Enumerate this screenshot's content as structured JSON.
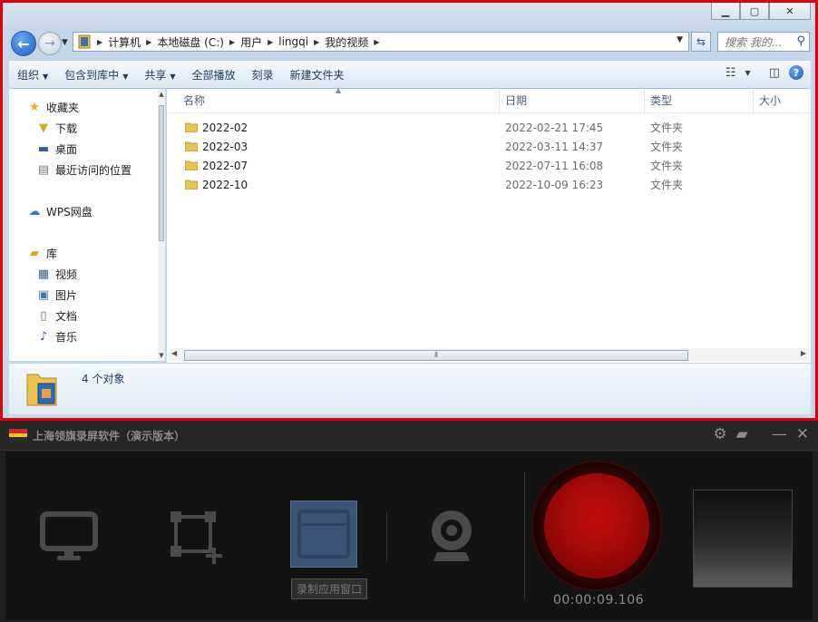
{
  "explorer": {
    "breadcrumbs": [
      "计算机",
      "本地磁盘 (C:)",
      "用户",
      "lingqi",
      "我的视频"
    ],
    "search_placeholder": "搜索 我的...",
    "toolbar": {
      "organize": "组织",
      "include_in_library": "包含到库中",
      "share": "共享",
      "play_all": "全部播放",
      "burn": "刻录",
      "new_folder": "新建文件夹"
    },
    "nav": {
      "favorites": "收藏夹",
      "downloads": "下载",
      "desktop": "桌面",
      "recent_places": "最近访问的位置",
      "wps": "WPS网盘",
      "libraries": "库",
      "videos": "视频",
      "pictures": "图片",
      "documents": "文档",
      "music": "音乐"
    },
    "columns": {
      "name": "名称",
      "date": "日期",
      "type": "类型",
      "size": "大小"
    },
    "files": [
      {
        "name": "2022-02",
        "date": "2022-02-21 17:45",
        "type": "文件夹"
      },
      {
        "name": "2022-03",
        "date": "2022-03-11 14:37",
        "type": "文件夹"
      },
      {
        "name": "2022-07",
        "date": "2022-07-11 16:08",
        "type": "文件夹"
      },
      {
        "name": "2022-10",
        "date": "2022-10-09 16:23",
        "type": "文件夹"
      }
    ],
    "status": "4 个对象"
  },
  "recorder": {
    "title": "上海领旗录屏软件（演示版本）",
    "tooltip": "录制应用窗口",
    "timer": "00:00:09.106"
  },
  "colors": {
    "highlight_frame": "#e00000",
    "record_red": "#b10b0b",
    "active_mode": "#3b5576"
  }
}
